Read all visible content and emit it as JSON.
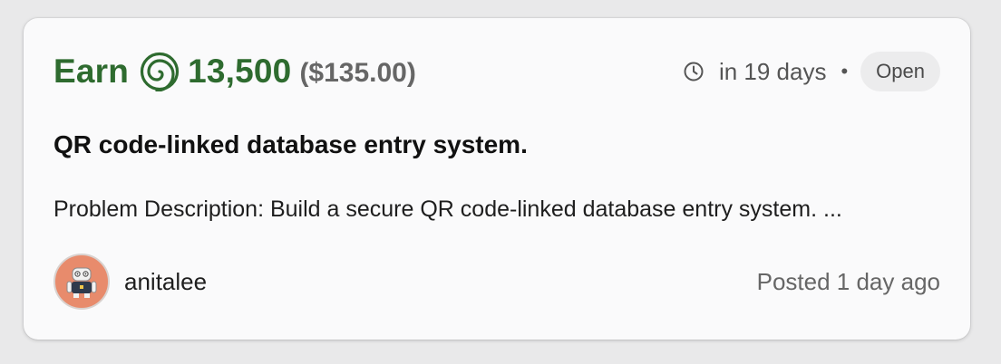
{
  "bounty": {
    "earn_label": "Earn",
    "coin_icon": "spiral-coin-icon",
    "amount": "13,500",
    "usd": "($135.00)",
    "deadline": "in 19 days",
    "separator": "•",
    "status": "Open",
    "title": "QR code-linked database entry system.",
    "description": "Problem Description: Build a secure QR code-linked database entry system. ...",
    "author": {
      "username": "anitalee",
      "avatar_icon": "robot-avatar-icon"
    },
    "posted": "Posted 1 day ago"
  },
  "colors": {
    "accent": "#2e6b2f",
    "muted": "#666666",
    "badge_bg": "#ececed",
    "avatar_bg": "#e88b6c"
  }
}
